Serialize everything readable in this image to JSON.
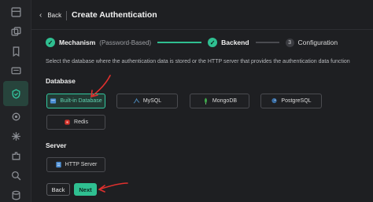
{
  "header": {
    "back_label": "Back",
    "title": "Create Authentication"
  },
  "steps": [
    {
      "label": "Mechanism",
      "sub": "(Password-Based)",
      "status": "done"
    },
    {
      "label": "Backend",
      "status": "done"
    },
    {
      "number": "3",
      "label": "Configuration",
      "status": "pending"
    }
  ],
  "description": "Select the database where the authentication data is stored or the HTTP server that provides the authentication data function",
  "database": {
    "title": "Database",
    "options": [
      {
        "label": "Built-in Database",
        "icon": "database-icon",
        "selected": true
      },
      {
        "label": "MySQL",
        "icon": "mysql-icon"
      },
      {
        "label": "MongoDB",
        "icon": "mongodb-icon"
      },
      {
        "label": "PostgreSQL",
        "icon": "postgresql-icon"
      },
      {
        "label": "Redis",
        "icon": "redis-icon"
      }
    ]
  },
  "server": {
    "title": "Server",
    "options": [
      {
        "label": "HTTP Server",
        "icon": "http-server-icon"
      }
    ]
  },
  "actions": {
    "back_label": "Back",
    "next_label": "Next"
  },
  "colors": {
    "accent": "#2fbf91",
    "annotation": "#e0302e",
    "background": "#1e1f22"
  }
}
